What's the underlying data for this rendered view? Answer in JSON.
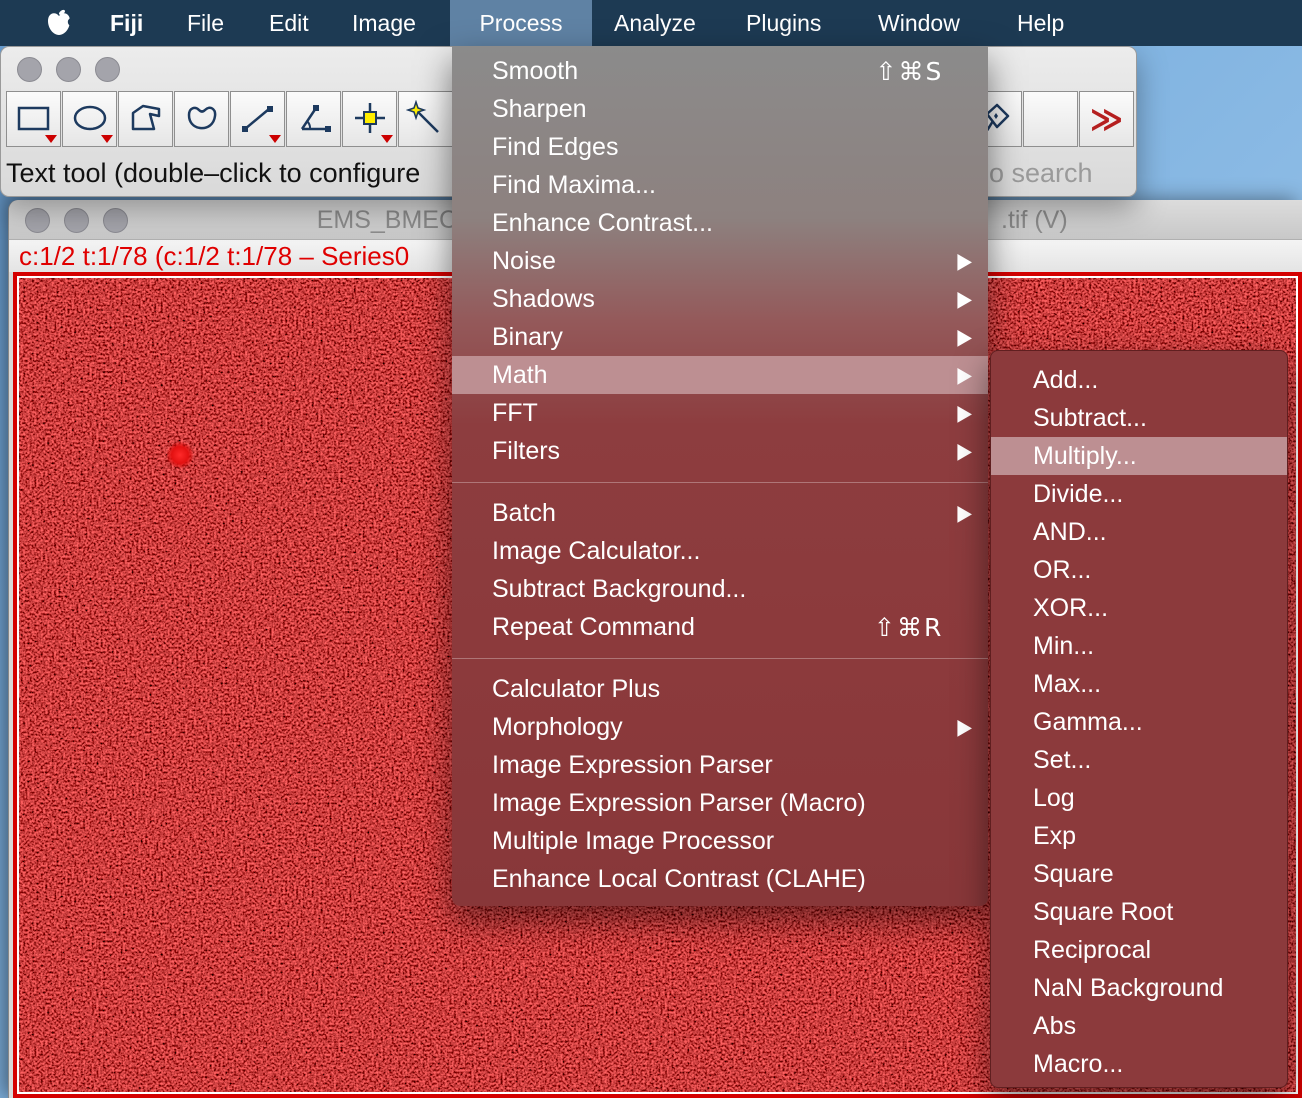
{
  "menu_bar": {
    "items": [
      {
        "label": "Fiji",
        "bold": true
      },
      {
        "label": "File"
      },
      {
        "label": "Edit"
      },
      {
        "label": "Image"
      },
      {
        "label": "Process",
        "active": true
      },
      {
        "label": "Analyze"
      },
      {
        "label": "Plugins"
      },
      {
        "label": "Window"
      },
      {
        "label": "Help"
      }
    ]
  },
  "process_menu": {
    "items": [
      {
        "label": "Smooth",
        "shortcut": "⇧⌘S"
      },
      {
        "label": "Sharpen"
      },
      {
        "label": "Find Edges"
      },
      {
        "label": "Find Maxima..."
      },
      {
        "label": "Enhance Contrast..."
      },
      {
        "label": "Noise",
        "submenu": true
      },
      {
        "label": "Shadows",
        "submenu": true
      },
      {
        "label": "Binary",
        "submenu": true
      },
      {
        "label": "Math",
        "submenu": true,
        "highlighted": true
      },
      {
        "label": "FFT",
        "submenu": true
      },
      {
        "label": "Filters",
        "submenu": true
      },
      {
        "separator": true
      },
      {
        "label": "Batch",
        "submenu": true
      },
      {
        "label": "Image Calculator..."
      },
      {
        "label": "Subtract Background..."
      },
      {
        "label": "Repeat Command",
        "shortcut": "⇧⌘R"
      },
      {
        "separator": true
      },
      {
        "label": "Calculator Plus"
      },
      {
        "label": "Morphology",
        "submenu": true
      },
      {
        "label": "Image Expression Parser"
      },
      {
        "label": "Image Expression Parser (Macro)"
      },
      {
        "label": "Multiple Image Processor"
      },
      {
        "label": "Enhance Local Contrast (CLAHE)"
      }
    ]
  },
  "math_submenu": {
    "items": [
      {
        "label": "Add..."
      },
      {
        "label": "Subtract..."
      },
      {
        "label": "Multiply...",
        "highlighted": true
      },
      {
        "label": "Divide..."
      },
      {
        "label": "AND..."
      },
      {
        "label": "OR..."
      },
      {
        "label": "XOR..."
      },
      {
        "label": "Min..."
      },
      {
        "label": "Max..."
      },
      {
        "label": "Gamma..."
      },
      {
        "label": "Set..."
      },
      {
        "label": "Log"
      },
      {
        "label": "Exp"
      },
      {
        "label": "Square"
      },
      {
        "label": "Square Root"
      },
      {
        "label": "Reciprocal"
      },
      {
        "label": "NaN Background"
      },
      {
        "label": "Abs"
      },
      {
        "label": "Macro..."
      }
    ]
  },
  "toolbar_window": {
    "status_text": "Text tool (double–click to configure",
    "search_fragment": "o search",
    "overflow_label": "≫",
    "tools": [
      "rectangle",
      "oval",
      "polygon",
      "freehand",
      "line",
      "angle",
      "point",
      "wand",
      "flood-fill",
      "spare",
      "overflow"
    ]
  },
  "image_window": {
    "title_left": "EMS_BMEC",
    "title_right": ".tif (V)",
    "info_text": "c:1/2 t:1/78 (c:1/2 t:1/78 – Series0"
  },
  "colors": {
    "menubar_bg": "#1d3a53",
    "menubar_active": "#5f82a4",
    "menu_red": "#8c3a3c",
    "menu_gray_top": "#8b8b8b",
    "menu_highlight": "#bd8f92",
    "canvas_border": "#d40000",
    "info_text_red": "#e00000",
    "sky_top": "#699fd4",
    "sky_bottom": "#a6cdee"
  }
}
